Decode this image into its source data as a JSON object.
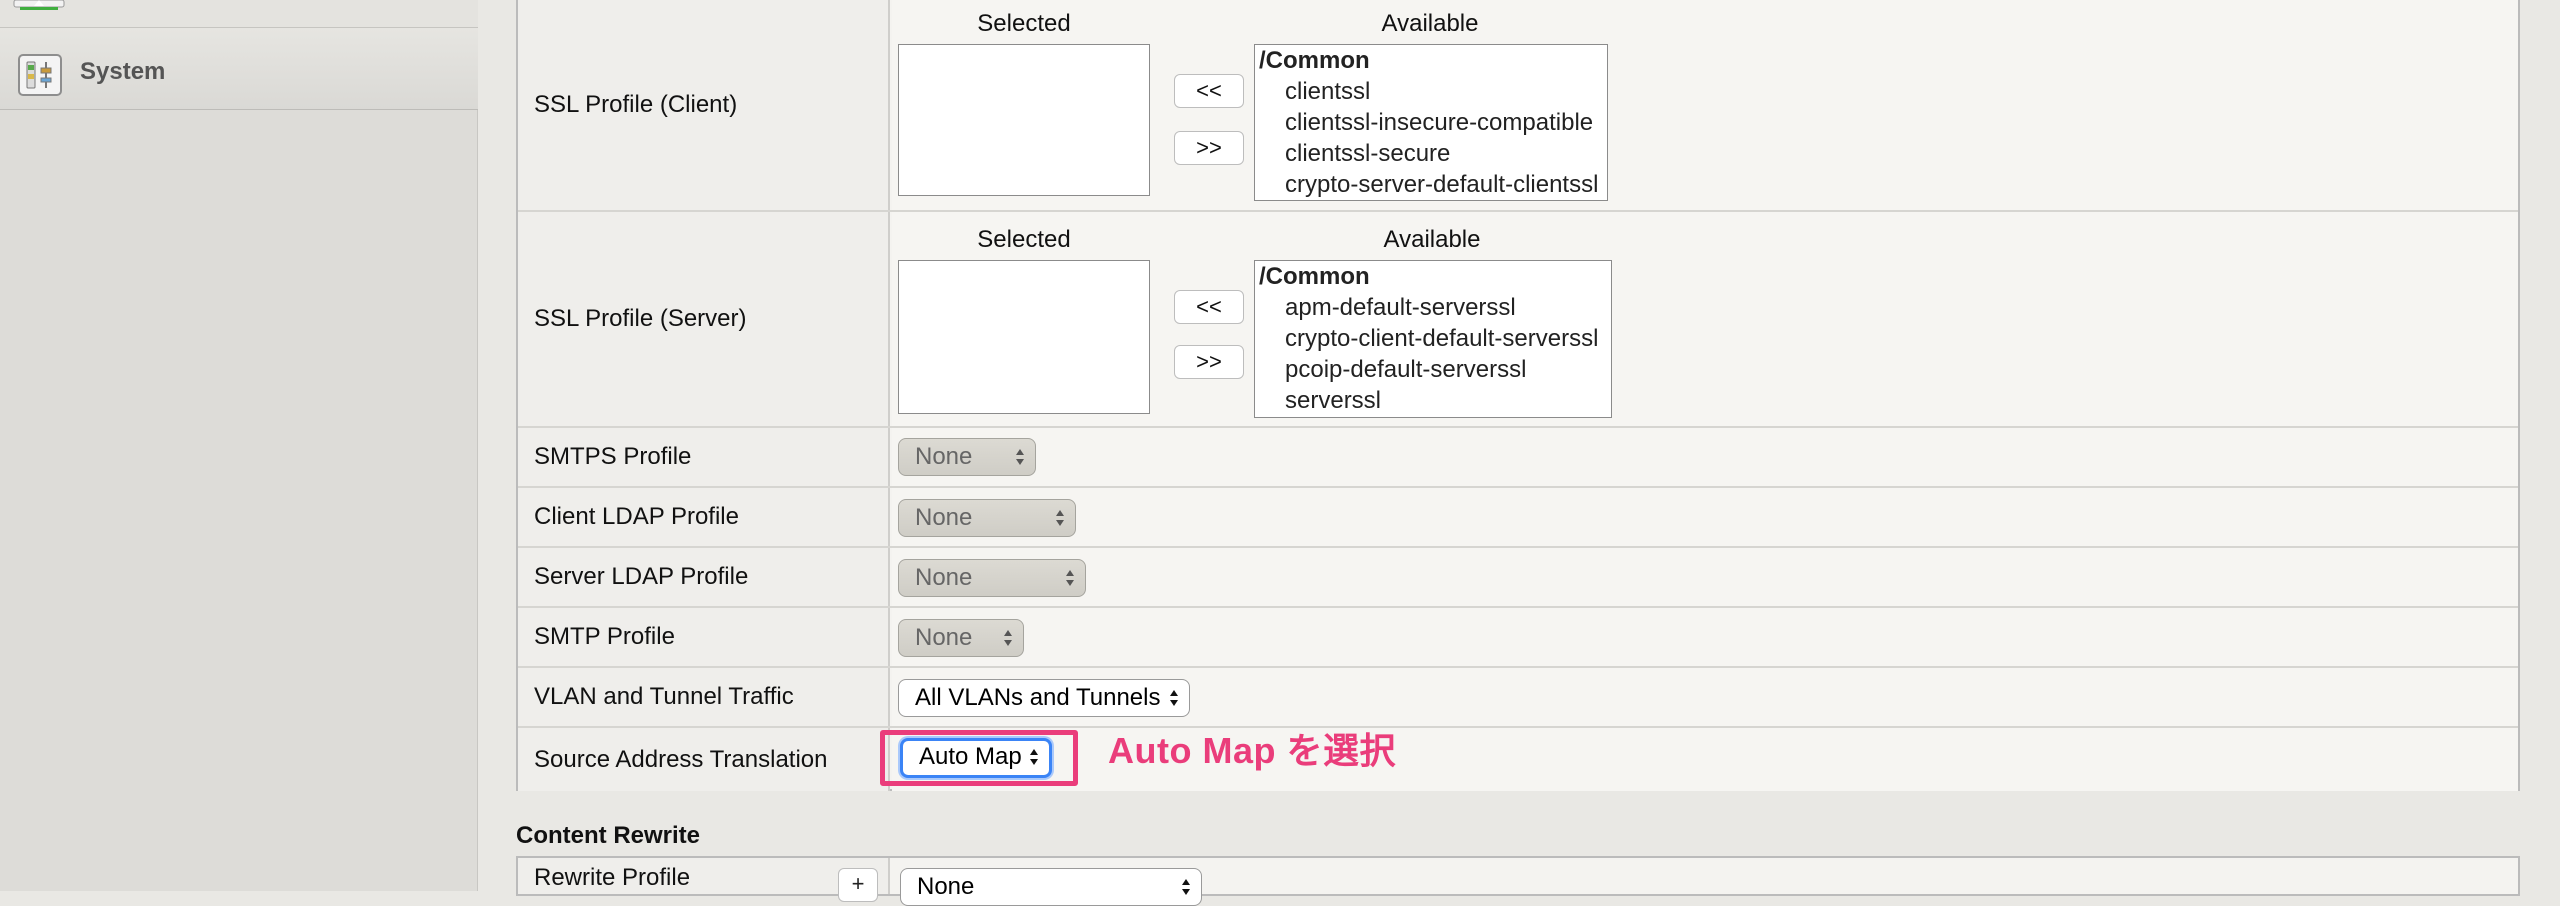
{
  "sidebar": {
    "items": [
      {
        "label": "System",
        "icon": "system-settings-icon"
      }
    ]
  },
  "ssl_client": {
    "label": "SSL Profile (Client)",
    "selected_header": "Selected",
    "available_header": "Available",
    "selected_items": [],
    "available_group": "/Common",
    "available_items": [
      "clientssl",
      "clientssl-insecure-compatible",
      "clientssl-secure",
      "crypto-server-default-clientssl"
    ],
    "move_left": "<<",
    "move_right": ">>"
  },
  "ssl_server": {
    "label": "SSL Profile (Server)",
    "selected_header": "Selected",
    "available_header": "Available",
    "selected_items": [],
    "available_group": "/Common",
    "available_items": [
      "apm-default-serverssl",
      "crypto-client-default-serverssl",
      "pcoip-default-serverssl",
      "serverssl"
    ],
    "move_left": "<<",
    "move_right": ">>"
  },
  "smtps_profile": {
    "label": "SMTPS Profile",
    "value": "None"
  },
  "client_ldap_profile": {
    "label": "Client LDAP Profile",
    "value": "None"
  },
  "server_ldap_profile": {
    "label": "Server LDAP Profile",
    "value": "None"
  },
  "smtp_profile": {
    "label": "SMTP Profile",
    "value": "None"
  },
  "vlan_tunnel": {
    "label": "VLAN and Tunnel Traffic",
    "value": "All VLANs and Tunnels"
  },
  "source_translation": {
    "label": "Source Address Translation",
    "value": "Auto Map"
  },
  "annotation": {
    "text": "Auto Map を選択",
    "color": "#ea3d7b"
  },
  "content_rewrite": {
    "title": "Content Rewrite",
    "rewrite_profile": {
      "label": "Rewrite Profile",
      "add": "+",
      "value": "None"
    }
  },
  "colors": {
    "focus_ring": "#3b84f6",
    "annotation": "#ea3d7b"
  }
}
